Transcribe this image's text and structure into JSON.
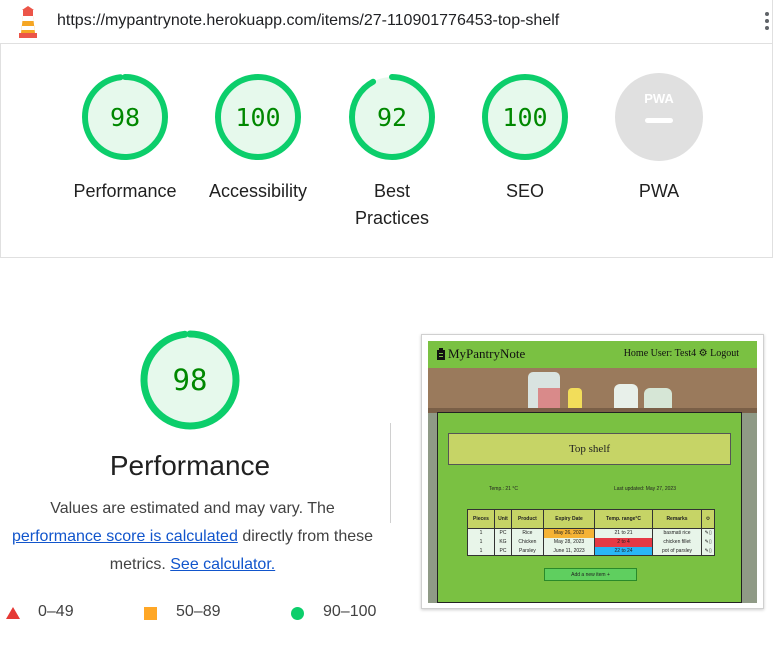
{
  "url_bar": {
    "url": "https://mypantrynote.herokuapp.com/items/27-110901776453-top-shelf"
  },
  "scores": [
    {
      "label": "Performance",
      "value": "98",
      "fraction": 0.98
    },
    {
      "label": "Accessibility",
      "value": "100",
      "fraction": 1.0
    },
    {
      "label": "Best Practices",
      "value": "92",
      "fraction": 0.92
    },
    {
      "label": "SEO",
      "value": "100",
      "fraction": 1.0
    },
    {
      "label": "PWA",
      "badge": "PWA"
    }
  ],
  "performance": {
    "score": "98",
    "fraction": 0.98,
    "title": "Performance",
    "desc_prefix": "Values are estimated and may vary. The",
    "link_score": "performance score is calculated",
    "desc_middle": "directly from these metrics.",
    "link_calculator": "See calculator."
  },
  "legend": [
    {
      "shape": "triangle",
      "range": "0–49",
      "color": "#e53935"
    },
    {
      "shape": "square",
      "range": "50–89",
      "color": "#ffa726"
    },
    {
      "shape": "circle",
      "range": "90–100",
      "color": "#0cce6b"
    }
  ],
  "colors": {
    "pass": "#0cce6b",
    "pass_text": "#008800",
    "pass_fill": "#e6f9ec",
    "na_fill": "#e0e0e0"
  },
  "app_screenshot": {
    "brand": "MyPantryNote",
    "nav": [
      "Home",
      "User: Test4",
      "Logout"
    ],
    "shelf_title": "Top shelf",
    "temp": "Temp.: 21 °C",
    "last_updated": "Last updated: May 27, 2023",
    "columns": [
      "Pieces",
      "Unit",
      "Product",
      "Expiry Date",
      "Temp. range°C",
      "Remarks"
    ],
    "rows": [
      [
        "1",
        "PC",
        "Rice",
        "May 26, 2023",
        "21 to 21",
        "basmati rice"
      ],
      [
        "1",
        "KG",
        "Chicken",
        "May 28, 2023",
        "2 to 4",
        "chicken fillet"
      ],
      [
        "1",
        "PC",
        "Parsley",
        "June 11, 2023",
        "22 to 24",
        "pot of parsley"
      ]
    ],
    "add_button": "Add a new item +"
  }
}
